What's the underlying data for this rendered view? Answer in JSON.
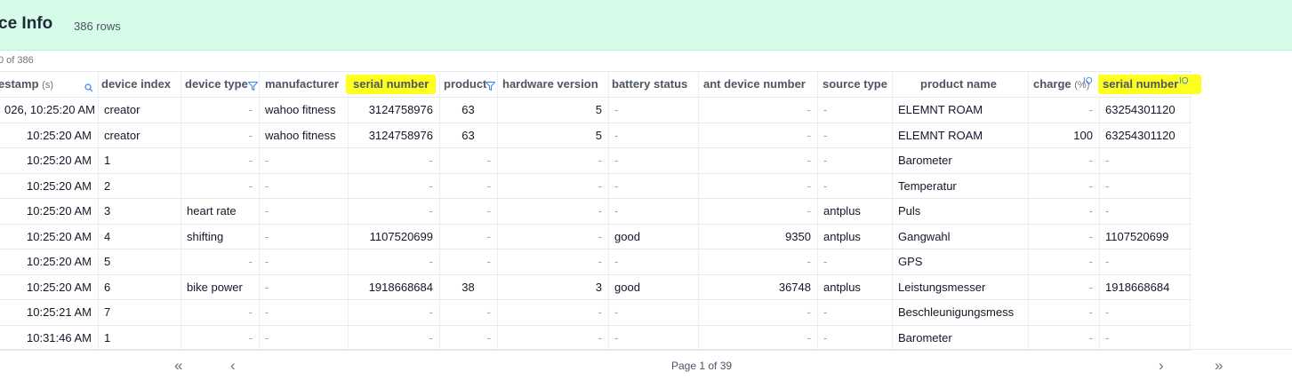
{
  "header": {
    "title": "ce Info",
    "row_count": "386 rows"
  },
  "range_text": "0 of 386",
  "columns": [
    {
      "key": "timestamp",
      "label": "estamp",
      "unit": "(s)"
    },
    {
      "key": "device_index",
      "label": "device index"
    },
    {
      "key": "device_type",
      "label": "device type"
    },
    {
      "key": "manufacturer",
      "label": "manufacturer"
    },
    {
      "key": "serial_number",
      "label": "serial number"
    },
    {
      "key": "product",
      "label": "product"
    },
    {
      "key": "hardware_version",
      "label": "hardware version"
    },
    {
      "key": "battery_status",
      "label": "battery status"
    },
    {
      "key": "ant_device_number",
      "label": "ant device number"
    },
    {
      "key": "source_type",
      "label": "source type"
    },
    {
      "key": "product_name",
      "label": "product name"
    },
    {
      "key": "charge",
      "label": "charge",
      "unit": "(%)"
    },
    {
      "key": "serial_number_2",
      "label": "serial number"
    }
  ],
  "rows": [
    [
      "026, 10:25:20 AM",
      "creator",
      "-",
      "wahoo fitness",
      "3124758976",
      "63",
      "5",
      "-",
      "-",
      "-",
      "ELEMNT ROAM",
      "-",
      "63254301120"
    ],
    [
      "10:25:20 AM",
      "creator",
      "-",
      "wahoo fitness",
      "3124758976",
      "63",
      "5",
      "-",
      "-",
      "-",
      "ELEMNT ROAM",
      "100",
      "63254301120"
    ],
    [
      "10:25:20 AM",
      "1",
      "-",
      "-",
      "-",
      "-",
      "-",
      "-",
      "-",
      "-",
      "Barometer",
      "-",
      "-"
    ],
    [
      "10:25:20 AM",
      "2",
      "-",
      "-",
      "-",
      "-",
      "-",
      "-",
      "-",
      "-",
      "Temperatur",
      "-",
      "-"
    ],
    [
      "10:25:20 AM",
      "3",
      "heart rate",
      "-",
      "-",
      "-",
      "-",
      "-",
      "-",
      "antplus",
      "Puls",
      "-",
      "-"
    ],
    [
      "10:25:20 AM",
      "4",
      "shifting",
      "-",
      "1107520699",
      "-",
      "-",
      "good",
      "9350",
      "antplus",
      "Gangwahl",
      "-",
      "1107520699"
    ],
    [
      "10:25:20 AM",
      "5",
      "-",
      "-",
      "-",
      "-",
      "-",
      "-",
      "-",
      "-",
      "GPS",
      "-",
      "-"
    ],
    [
      "10:25:20 AM",
      "6",
      "bike power",
      "-",
      "1918668684",
      "38",
      "3",
      "good",
      "36748",
      "antplus",
      "Leistungsmesser",
      "-",
      "1918668684"
    ],
    [
      "10:25:21 AM",
      "7",
      "-",
      "-",
      "-",
      "-",
      "-",
      "-",
      "-",
      "-",
      "Beschleunigungsmess",
      "-",
      "-"
    ],
    [
      "10:31:46 AM",
      "1",
      "-",
      "-",
      "-",
      "-",
      "-",
      "-",
      "-",
      "-",
      "Barometer",
      "-",
      "-"
    ]
  ],
  "icons": {
    "search": "search-icon",
    "filter": "filter-icon",
    "sort": "sort-icon"
  },
  "pager": {
    "first": "«",
    "prev": "‹",
    "page_text": "Page 1 of 39",
    "next": "›",
    "last": "»"
  },
  "colors": {
    "header_bg": "#d6fbe8",
    "highlight": "#ffff1f",
    "accent": "#3b82f6"
  }
}
